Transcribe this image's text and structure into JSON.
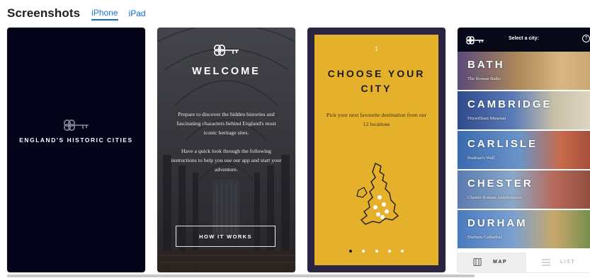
{
  "header": {
    "title": "Screenshots",
    "tabs": [
      {
        "label": "iPhone",
        "active": true
      },
      {
        "label": "iPad",
        "active": false
      }
    ]
  },
  "colors": {
    "accent": "#0b6cd6",
    "dark_bg": "#03031a",
    "mustard": "#e5b12b"
  },
  "screenshots": [
    {
      "brand": "ENGLAND'S HISTORIC CITIES",
      "icon": "key-icon"
    },
    {
      "heading": "WELCOME",
      "paragraph1": "Prepare to discover the hidden histories and fascinating characters behind England's most iconic heritage sites.",
      "paragraph2": "Have a quick look through the following instructions to help you use our app and start your adventure.",
      "button_label": "HOW IT WORKS",
      "icon": "key-icon"
    },
    {
      "step_number": "1",
      "heading_line1": "CHOOSE YOUR",
      "heading_line2": "CITY",
      "description": "Pick your next favourite destination from our 12 locations",
      "page_dots": 5,
      "active_dot": 0,
      "icon": "uk-map-icon"
    },
    {
      "select_label": "Select a city:",
      "help_label": "?",
      "cities": [
        {
          "name": "BATH",
          "landmark": "The Roman Baths"
        },
        {
          "name": "CAMBRIDGE",
          "landmark": "Fitzwilliam Museum"
        },
        {
          "name": "CARLISLE",
          "landmark": "Hadrian's Wall"
        },
        {
          "name": "CHESTER",
          "landmark": "Chester Roman Amphitheatre"
        },
        {
          "name": "DURHAM",
          "landmark": "Durham Cathedral"
        }
      ],
      "map_label": "MAP",
      "list_label": "LIST"
    }
  ]
}
